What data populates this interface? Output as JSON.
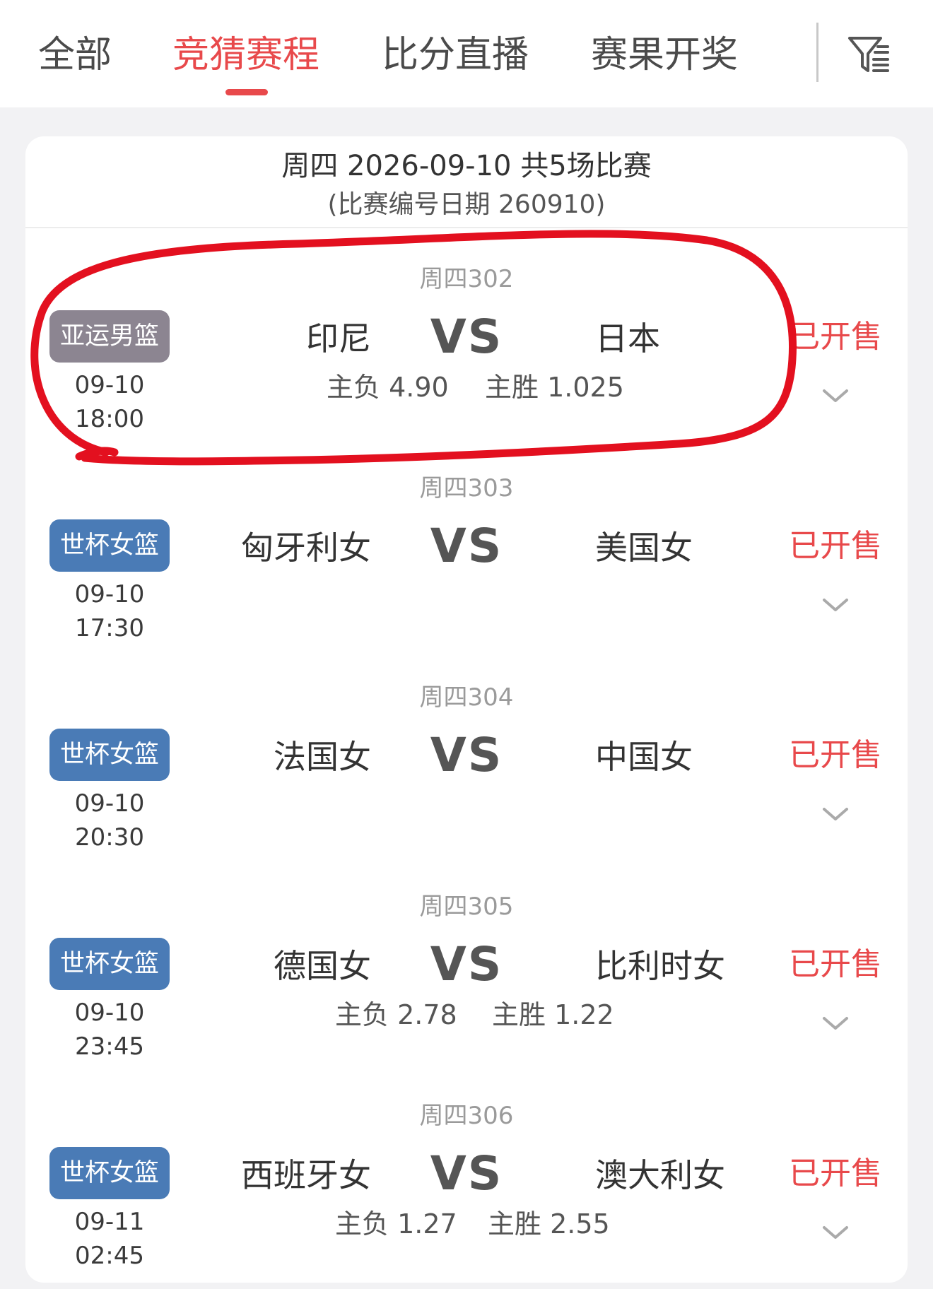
{
  "tabs": [
    {
      "label": "全部",
      "active": false
    },
    {
      "label": "竞猜赛程",
      "active": true
    },
    {
      "label": "比分直播",
      "active": false
    },
    {
      "label": "赛果开奖",
      "active": false
    }
  ],
  "filter": {
    "icon": "filter-icon"
  },
  "colors": {
    "accent": "#e8494b",
    "badge_asian_games": "#8c8591",
    "badge_world_cup": "#4a7bb6",
    "annotation": "#e3101f"
  },
  "day": {
    "title": "周四 2026-09-10 共5场比赛",
    "subtitle": "(比赛编号日期 260910)"
  },
  "matches": [
    {
      "no": "周四302",
      "league": "亚运男篮",
      "date": "09-10",
      "time": "18:00",
      "home": "印尼",
      "vs": "VS",
      "away": "日本",
      "odds_lose": "主负 4.90",
      "odds_win": "主胜 1.025",
      "status": "已开售"
    },
    {
      "no": "周四303",
      "league": "世杯女篮",
      "date": "09-10",
      "time": "17:30",
      "home": "匈牙利女",
      "vs": "VS",
      "away": "美国女",
      "odds_lose": "",
      "odds_win": "",
      "status": "已开售"
    },
    {
      "no": "周四304",
      "league": "世杯女篮",
      "date": "09-10",
      "time": "20:30",
      "home": "法国女",
      "vs": "VS",
      "away": "中国女",
      "odds_lose": "",
      "odds_win": "",
      "status": "已开售"
    },
    {
      "no": "周四305",
      "league": "世杯女篮",
      "date": "09-10",
      "time": "23:45",
      "home": "德国女",
      "vs": "VS",
      "away": "比利时女",
      "odds_lose": "主负 2.78",
      "odds_win": "主胜 1.22",
      "status": "已开售"
    },
    {
      "no": "周四306",
      "league": "世杯女篮",
      "date": "09-11",
      "time": "02:45",
      "home": "西班牙女",
      "vs": "VS",
      "away": "澳大利女",
      "odds_lose": "主负 1.27",
      "odds_win": "主胜 2.55",
      "status": "已开售"
    }
  ]
}
